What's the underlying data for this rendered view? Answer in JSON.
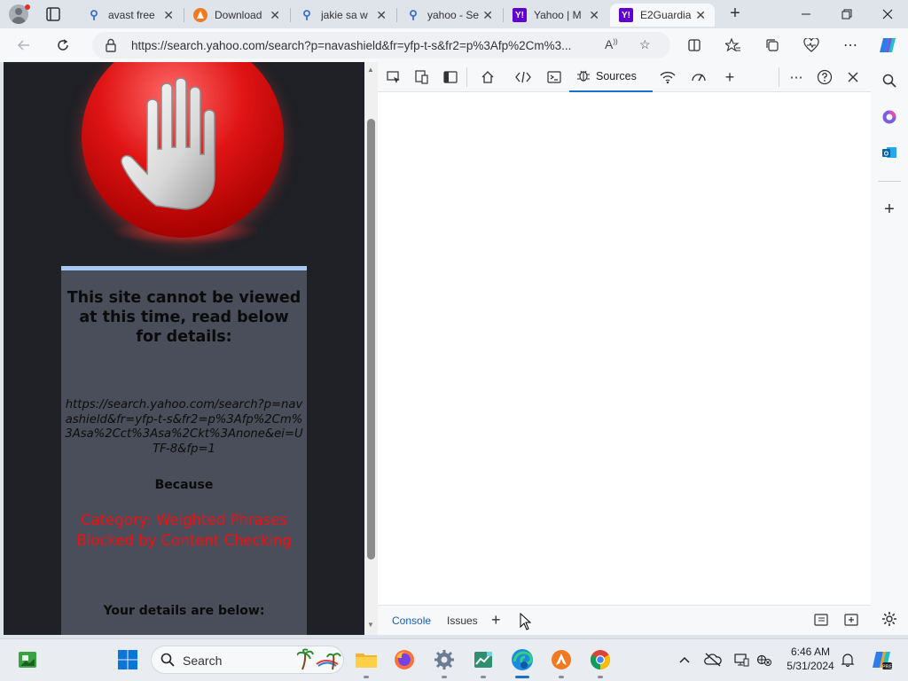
{
  "browser": {
    "tabs": [
      {
        "title": "avast free",
        "favicon": "search-icon"
      },
      {
        "title": "Download",
        "favicon": "avast-icon"
      },
      {
        "title": "jakie sa w",
        "favicon": "search-icon"
      },
      {
        "title": "yahoo - Se",
        "favicon": "search-icon"
      },
      {
        "title": "Yahoo | M",
        "favicon": "yahoo-icon"
      },
      {
        "title": "E2Guardia",
        "favicon": "yahoo-icon",
        "active": true
      }
    ],
    "yahoo_glyph": "Y!",
    "url": "https://search.yahoo.com/search?p=navashield&fr=yfp-t-s&fr2=p%3Afp%2Cm%3...",
    "read_aloud_glyph": "A"
  },
  "block_page": {
    "title": "This site cannot be viewed at this time, read below for details:",
    "blocked_url": "https://search.yahoo.com/search?p=navashield&fr=yfp-t-s&fr2=p%3Afp%2Cm%3Asa%2Cct%3Asa%2Ckt%3Anone&ei=UTF-8&fp=1",
    "because_label": "Because",
    "reason_line1": "Category: Weighted Phrases",
    "reason_line2": "Blocked by Content Checking",
    "details_label": "Your details are below:"
  },
  "devtools": {
    "active_tab": "Sources",
    "drawer_tabs": [
      "Console",
      "Issues"
    ]
  },
  "taskbar": {
    "search_label": "Search",
    "time": "6:46 AM",
    "date": "5/31/2024"
  },
  "colors": {
    "accent": "#1a73c9",
    "block_reason": "#f30f0f",
    "block_box": "#4a4d5a",
    "page_bg": "#1f2126"
  }
}
